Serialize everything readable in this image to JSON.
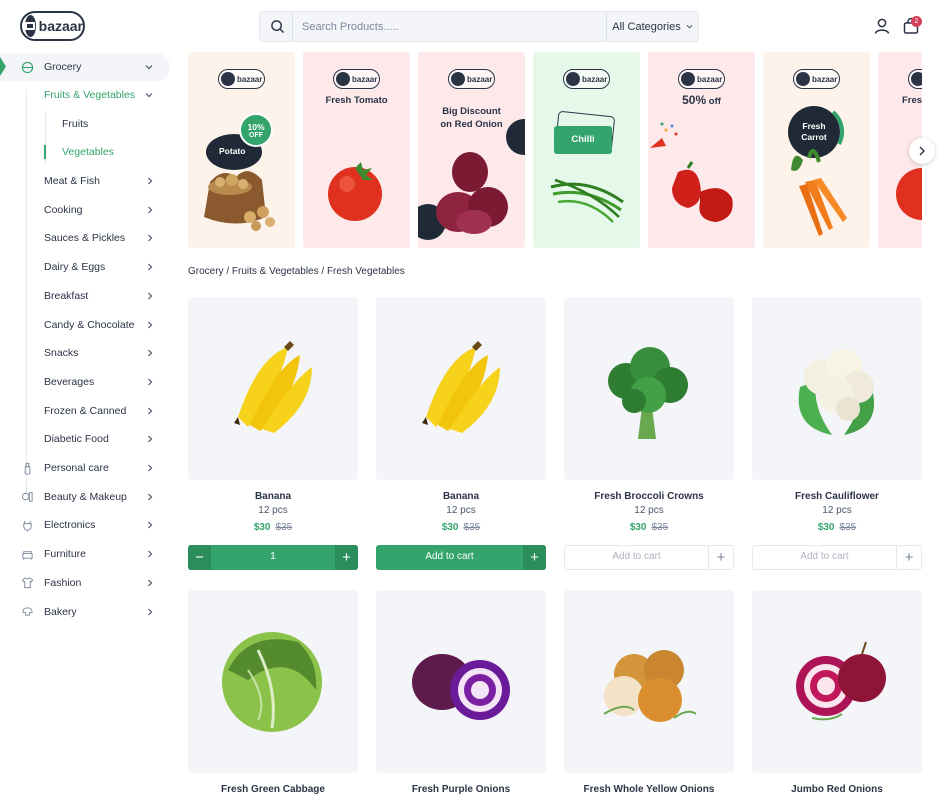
{
  "header": {
    "logo_text": "bazaar",
    "search_placeholder": "Search Products.....",
    "category_label": "All Categories",
    "cart_count": "2",
    "icons": [
      "search-icon",
      "chevron-down-icon",
      "user-icon",
      "shopping-bag-icon"
    ]
  },
  "sidebar": {
    "grocery": "Grocery",
    "fruits_veg": "Fruits & Vegetables",
    "fruits": "Fruits",
    "vegetables": "Vegetables",
    "items": [
      "Meat & Fish",
      "Cooking",
      "Sauces & Pickles",
      "Dairy & Eggs",
      "Breakfast",
      "Candy & Chocolate",
      "Snacks",
      "Beverages",
      "Frozen & Canned",
      "Diabetic Food"
    ],
    "top_items": [
      {
        "label": "Personal care",
        "icon": "personal-care-icon"
      },
      {
        "label": "Beauty & Makeup",
        "icon": "beauty-icon"
      },
      {
        "label": "Electronics",
        "icon": "plug-icon"
      },
      {
        "label": "Furniture",
        "icon": "sofa-icon"
      },
      {
        "label": "Fashion",
        "icon": "tshirt-icon"
      },
      {
        "label": "Bakery",
        "icon": "bakery-icon"
      }
    ]
  },
  "banners": {
    "logo_text": "bazaar",
    "potato": {
      "label": "Potato",
      "discount": "10%",
      "discount_suffix": "OFF"
    },
    "tomato": {
      "title": "Fresh Tomato"
    },
    "onion": {
      "title_line1": "Big Discount",
      "title_line2": "on Red Onion"
    },
    "chilli": {
      "label": "Chilli"
    },
    "pepper": {
      "title": "50%",
      "title_suffix": " off"
    },
    "carrot": {
      "line1": "Fresh",
      "line2": "Carrot"
    },
    "partial": {
      "title": "Fresh"
    }
  },
  "breadcrumb": "Grocery / Fruits & Vegetables / Fresh Vegetables",
  "products": [
    {
      "name": "Banana",
      "unit": "12 pcs",
      "price": "$30",
      "old_price": "$35",
      "action": "stepper",
      "qty": "1"
    },
    {
      "name": "Banana",
      "unit": "12 pcs",
      "price": "$30",
      "old_price": "$35",
      "action": "add-solid",
      "add_label": "Add to cart"
    },
    {
      "name": "Fresh Broccoli Crowns",
      "unit": "12 pcs",
      "price": "$30",
      "old_price": "$35",
      "action": "add-outline",
      "add_label": "Add to cart"
    },
    {
      "name": "Fresh Cauliflower",
      "unit": "12 pcs",
      "price": "$30",
      "old_price": "$35",
      "action": "add-outline",
      "add_label": "Add to cart"
    },
    {
      "name": "Fresh Green Cabbage"
    },
    {
      "name": "Fresh Purple Onions"
    },
    {
      "name": "Fresh Whole Yellow Onions"
    },
    {
      "name": "Jumbo Red Onions"
    }
  ],
  "colors": {
    "accent": "#33a46c",
    "accent_dark": "#2a8d5b",
    "text": "#2b3445",
    "badge": "#d23f57",
    "card_bg": "#f3f5f9"
  }
}
